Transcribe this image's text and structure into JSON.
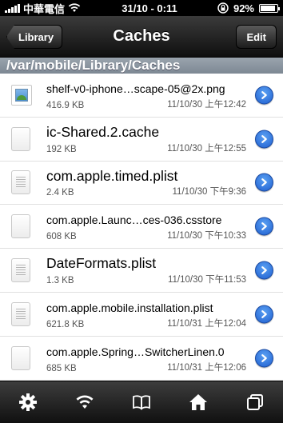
{
  "status_bar": {
    "carrier": "中華電信",
    "time": "31/10 - 0:11",
    "battery": "92%",
    "battery_level": 0.92
  },
  "nav": {
    "back_label": "Library",
    "title": "Caches",
    "edit_label": "Edit"
  },
  "path": "/var/mobile/Library/Caches",
  "files": [
    {
      "name": "shelf-v0-iphone…scape-05@2x.png",
      "size": "416.9 KB",
      "date": "11/10/30 上午12:42",
      "icon": "image-file-icon",
      "style": "small"
    },
    {
      "name": "ic-Shared.2.cache",
      "size": "192 KB",
      "date": "11/10/30 上午12:55",
      "icon": "blank-file-icon",
      "style": "large"
    },
    {
      "name": "com.apple.timed.plist",
      "size": "2.4 KB",
      "date": "11/10/30 下午9:36",
      "icon": "text-file-icon",
      "style": "large"
    },
    {
      "name": "com.apple.Launc…ces-036.csstore",
      "size": "608 KB",
      "date": "11/10/30 下午10:33",
      "icon": "blank-file-icon",
      "style": "small"
    },
    {
      "name": "DateFormats.plist",
      "size": "1.3 KB",
      "date": "11/10/30 下午11:53",
      "icon": "text-file-icon",
      "style": "large"
    },
    {
      "name": "com.apple.mobile.installation.plist",
      "size": "621.8 KB",
      "date": "11/10/31 上午12:04",
      "icon": "text-file-icon",
      "style": "small"
    },
    {
      "name": "com.apple.Spring…SwitcherLinen.0",
      "size": "685 KB",
      "date": "11/10/31 上午12:06",
      "icon": "blank-file-icon",
      "style": "small"
    }
  ],
  "toolbar": {
    "items": [
      "gear-icon",
      "wifi-icon",
      "book-icon",
      "home-icon",
      "windows-icon"
    ]
  }
}
